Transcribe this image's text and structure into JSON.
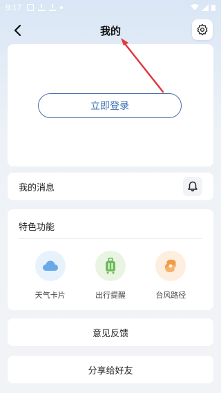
{
  "status_bar": {
    "time": "9:17"
  },
  "header": {
    "title": "我的"
  },
  "login": {
    "button_label": "立即登录"
  },
  "messages": {
    "label": "我的消息"
  },
  "features": {
    "title": "特色功能",
    "items": [
      {
        "label": "天气卡片",
        "icon": "cloud-icon",
        "bg": "#e8f2fc",
        "color": "#6aa9e8"
      },
      {
        "label": "出行提醒",
        "icon": "luggage-icon",
        "bg": "#e9f4e3",
        "color": "#6dbb5a"
      },
      {
        "label": "台风路径",
        "icon": "typhoon-icon",
        "bg": "#fdeee0",
        "color": "#f29a45"
      }
    ]
  },
  "menu": {
    "feedback_label": "意见反馈",
    "share_label": "分享给好友"
  },
  "colors": {
    "accent": "#3d6fb4",
    "annotation_arrow": "#e0393e"
  }
}
